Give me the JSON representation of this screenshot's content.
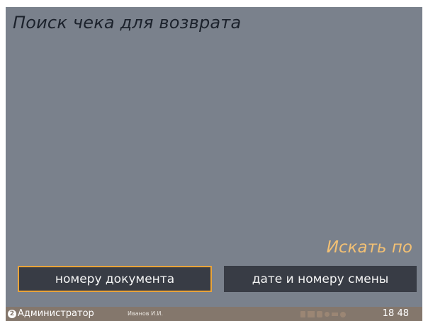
{
  "screen": {
    "title": "Поиск чека для возврата",
    "search_by_label": "Искать по"
  },
  "buttons": {
    "by_document_number": "номеру документа",
    "by_date_and_shift": "дате и номеру смены"
  },
  "status_bar": {
    "role_badge": "2",
    "role": "Администратор",
    "user": "Иванов И.И.",
    "time": "18 48",
    "tray_icons": [
      "printer-icon",
      "keyboard-icon",
      "network-icon",
      "scanner-icon",
      "connection-icon",
      "power-icon"
    ]
  },
  "colors": {
    "background": "#7a818c",
    "button": "#383c45",
    "accent": "#e9a43a",
    "search_label": "#f2c074",
    "status_bar": "#84776c"
  }
}
